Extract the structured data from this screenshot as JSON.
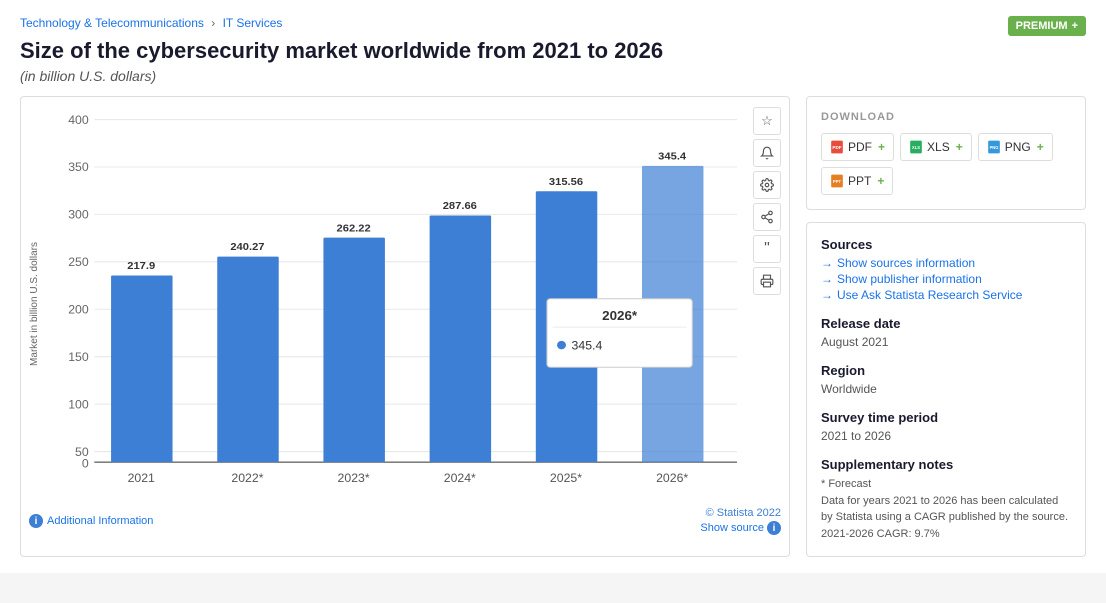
{
  "breadcrumb": {
    "part1": "Technology & Telecommunications",
    "separator": "›",
    "part2": "IT Services"
  },
  "premium": {
    "label": "PREMIUM",
    "plus": "+"
  },
  "title": "Size of the cybersecurity market worldwide from 2021 to 2026",
  "subtitle": "(in billion U.S. dollars)",
  "chart": {
    "y_axis_label": "Market in billion U.S. dollars",
    "y_ticks": [
      "400",
      "350",
      "300",
      "250",
      "200",
      "150",
      "100",
      "50",
      "0"
    ],
    "bars": [
      {
        "year": "2021",
        "value": "217.9",
        "height_pct": 54.5
      },
      {
        "year": "2022*",
        "value": "240.27",
        "height_pct": 60.1
      },
      {
        "year": "2023*",
        "value": "262.22",
        "height_pct": 65.6
      },
      {
        "year": "2024*",
        "value": "287.66",
        "height_pct": 71.9
      },
      {
        "year": "2025*",
        "value": "315.56",
        "height_pct": 78.9
      },
      {
        "year": "2026*",
        "value": "345.4",
        "height_pct": 86.4
      }
    ],
    "tooltip": {
      "title": "2026*",
      "value": "345.4"
    },
    "footer": {
      "additional_info": "Additional Information",
      "statista_credit": "© Statista 2022",
      "show_source": "Show source"
    }
  },
  "toolbar": {
    "star": "☆",
    "bell": "🔔",
    "gear": "⚙",
    "share": "⋯",
    "quote": "❝",
    "print": "🖨"
  },
  "download": {
    "title": "DOWNLOAD",
    "buttons": [
      {
        "label": "PDF",
        "icon": "pdf",
        "plus": "+"
      },
      {
        "label": "XLS",
        "icon": "xls",
        "plus": "+"
      },
      {
        "label": "PNG",
        "icon": "png",
        "plus": "+"
      },
      {
        "label": "PPT",
        "icon": "ppt",
        "plus": "+"
      }
    ]
  },
  "sources_section": {
    "label": "Sources",
    "links": [
      {
        "text": "Show sources information"
      },
      {
        "text": "Show publisher information"
      },
      {
        "text": "Use Ask Statista Research Service"
      }
    ]
  },
  "release_date": {
    "label": "Release date",
    "value": "August 2021"
  },
  "region": {
    "label": "Region",
    "value": "Worldwide"
  },
  "survey_period": {
    "label": "Survey time period",
    "value": "2021 to 2026"
  },
  "supplementary_notes": {
    "label": "Supplementary notes",
    "lines": [
      "* Forecast",
      "Data for years 2021 to 2026 has been calculated by Statista using a CAGR published by the source.",
      "2021-2026 CAGR: 9.7%"
    ]
  }
}
